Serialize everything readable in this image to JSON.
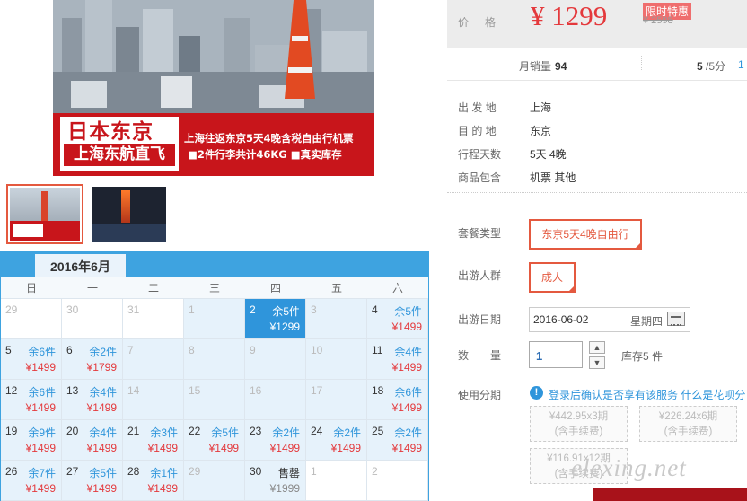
{
  "banner": {
    "title": "日本东京",
    "subtitle": "上海东航直飞",
    "desc1": "上海往返东京5天4晚含税自由行机票",
    "desc2": "■2件行李共计46KG  ■真实库存"
  },
  "calendar": {
    "month_label": "2016年6月",
    "weekdays": [
      "日",
      "一",
      "二",
      "三",
      "四",
      "五",
      "六"
    ],
    "rows": [
      [
        {
          "d": "29",
          "off": true
        },
        {
          "d": "30",
          "off": true
        },
        {
          "d": "31",
          "off": true
        },
        {
          "d": "1",
          "avail": true,
          "off": true
        },
        {
          "d": "2",
          "s": "余5件",
          "p": "¥1299",
          "sel": true
        },
        {
          "d": "3",
          "avail": true,
          "off": true
        },
        {
          "d": "4",
          "s": "余5件",
          "p": "¥1499",
          "avail": true
        }
      ],
      [
        {
          "d": "5",
          "s": "余6件",
          "p": "¥1499",
          "avail": true
        },
        {
          "d": "6",
          "s": "余2件",
          "p": "¥1799",
          "avail": true
        },
        {
          "d": "7",
          "avail": true,
          "off": true
        },
        {
          "d": "8",
          "avail": true,
          "off": true
        },
        {
          "d": "9",
          "avail": true,
          "off": true
        },
        {
          "d": "10",
          "avail": true,
          "off": true
        },
        {
          "d": "11",
          "s": "余4件",
          "p": "¥1499",
          "avail": true
        }
      ],
      [
        {
          "d": "12",
          "s": "余6件",
          "p": "¥1499",
          "avail": true
        },
        {
          "d": "13",
          "s": "余4件",
          "p": "¥1499",
          "avail": true
        },
        {
          "d": "14",
          "avail": true,
          "off": true
        },
        {
          "d": "15",
          "avail": true,
          "off": true
        },
        {
          "d": "16",
          "avail": true,
          "off": true
        },
        {
          "d": "17",
          "avail": true,
          "off": true
        },
        {
          "d": "18",
          "s": "余6件",
          "p": "¥1499",
          "avail": true
        }
      ],
      [
        {
          "d": "19",
          "s": "余9件",
          "p": "¥1499",
          "avail": true
        },
        {
          "d": "20",
          "s": "余4件",
          "p": "¥1499",
          "avail": true
        },
        {
          "d": "21",
          "s": "余3件",
          "p": "¥1499",
          "avail": true
        },
        {
          "d": "22",
          "s": "余5件",
          "p": "¥1499",
          "avail": true
        },
        {
          "d": "23",
          "s": "余2件",
          "p": "¥1499",
          "avail": true
        },
        {
          "d": "24",
          "s": "余2件",
          "p": "¥1499",
          "avail": true
        },
        {
          "d": "25",
          "s": "余2件",
          "p": "¥1499",
          "avail": true
        }
      ],
      [
        {
          "d": "26",
          "s": "余7件",
          "p": "¥1499",
          "avail": true
        },
        {
          "d": "27",
          "s": "余5件",
          "p": "¥1499",
          "avail": true
        },
        {
          "d": "28",
          "s": "余1件",
          "p": "¥1499",
          "avail": true
        },
        {
          "d": "29",
          "avail": true,
          "off": true
        },
        {
          "d": "30",
          "s": "售罄",
          "p": "¥1999",
          "avail": true,
          "sold": true
        },
        {
          "d": "1",
          "off": true
        },
        {
          "d": "2",
          "off": true
        }
      ]
    ]
  },
  "price": {
    "label": "价格",
    "value": "¥ 1299",
    "badge": "限时特惠",
    "old": "¥ 2598"
  },
  "sales": {
    "label": "月销量",
    "count": "94",
    "rating": "5",
    "rating_suffix": "/5分",
    "rating_extra": "1"
  },
  "info": [
    {
      "label": "出 发 地",
      "value": "上海"
    },
    {
      "label": "目 的 地",
      "value": "东京"
    },
    {
      "label": "行程天数",
      "value": "5天 4晚"
    },
    {
      "label": "商品包含",
      "value": "机票  其他"
    }
  ],
  "options": {
    "package_label": "套餐类型",
    "package_value": "东京5天4晚自由行",
    "people_label": "出游人群",
    "people_value": "成人",
    "date_label": "出游日期",
    "date_value": "2016-06-02",
    "date_week": "星期四",
    "qty_label": "数　　量",
    "qty_value": "1",
    "stock": "库存5 件"
  },
  "installment": {
    "label": "使用分期",
    "note_prefix": "登录后确认是否享有该服务",
    "note_link": "什么是花呗分",
    "plans": [
      {
        "line1": "¥442.95x3期",
        "line2": "(含手续费)"
      },
      {
        "line1": "¥226.24x6期",
        "line2": "(含手续费)"
      },
      {
        "line1": "¥116.91x12期",
        "line2": "(含手续费)"
      }
    ]
  },
  "watermark": "elexing.net"
}
